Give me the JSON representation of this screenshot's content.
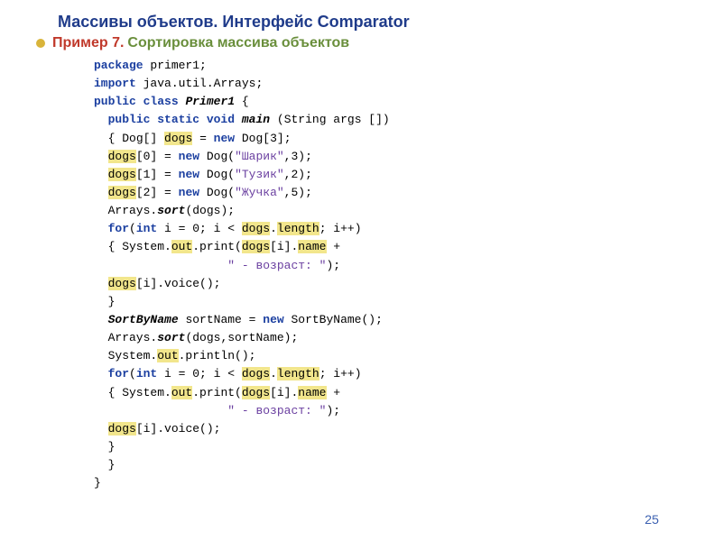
{
  "title": "Массивы объектов. Интерфейс Comparator",
  "subtitle_strong": "Пример 7.",
  "subtitle_rest": "Сортировка массива объектов",
  "page_number": "25",
  "code": {
    "pkg": "primer1",
    "import": "java.util.Arrays",
    "class_name": "Primer1",
    "main_sig_args": "(String args [])",
    "arr_decl_type": "Dog[]",
    "arr_name": "dogs",
    "arr_size": "3",
    "dog0_name": "\"Шарик\"",
    "dog0_age": "3",
    "dog1_name": "\"Тузик\"",
    "dog1_age": "2",
    "dog2_name": "\"Жучка\"",
    "dog2_age": "5",
    "sort_call": "(dogs)",
    "length_word": "length",
    "out_word": "out",
    "name_word": "name",
    "age_label": "\" - возраст: \"",
    "voice_suffix": ".voice();",
    "sortbyname_type": "SortByName",
    "sortbyname_var": "sortName",
    "sort2_call": "(dogs,sortName)",
    "println_empty": ".println();"
  }
}
